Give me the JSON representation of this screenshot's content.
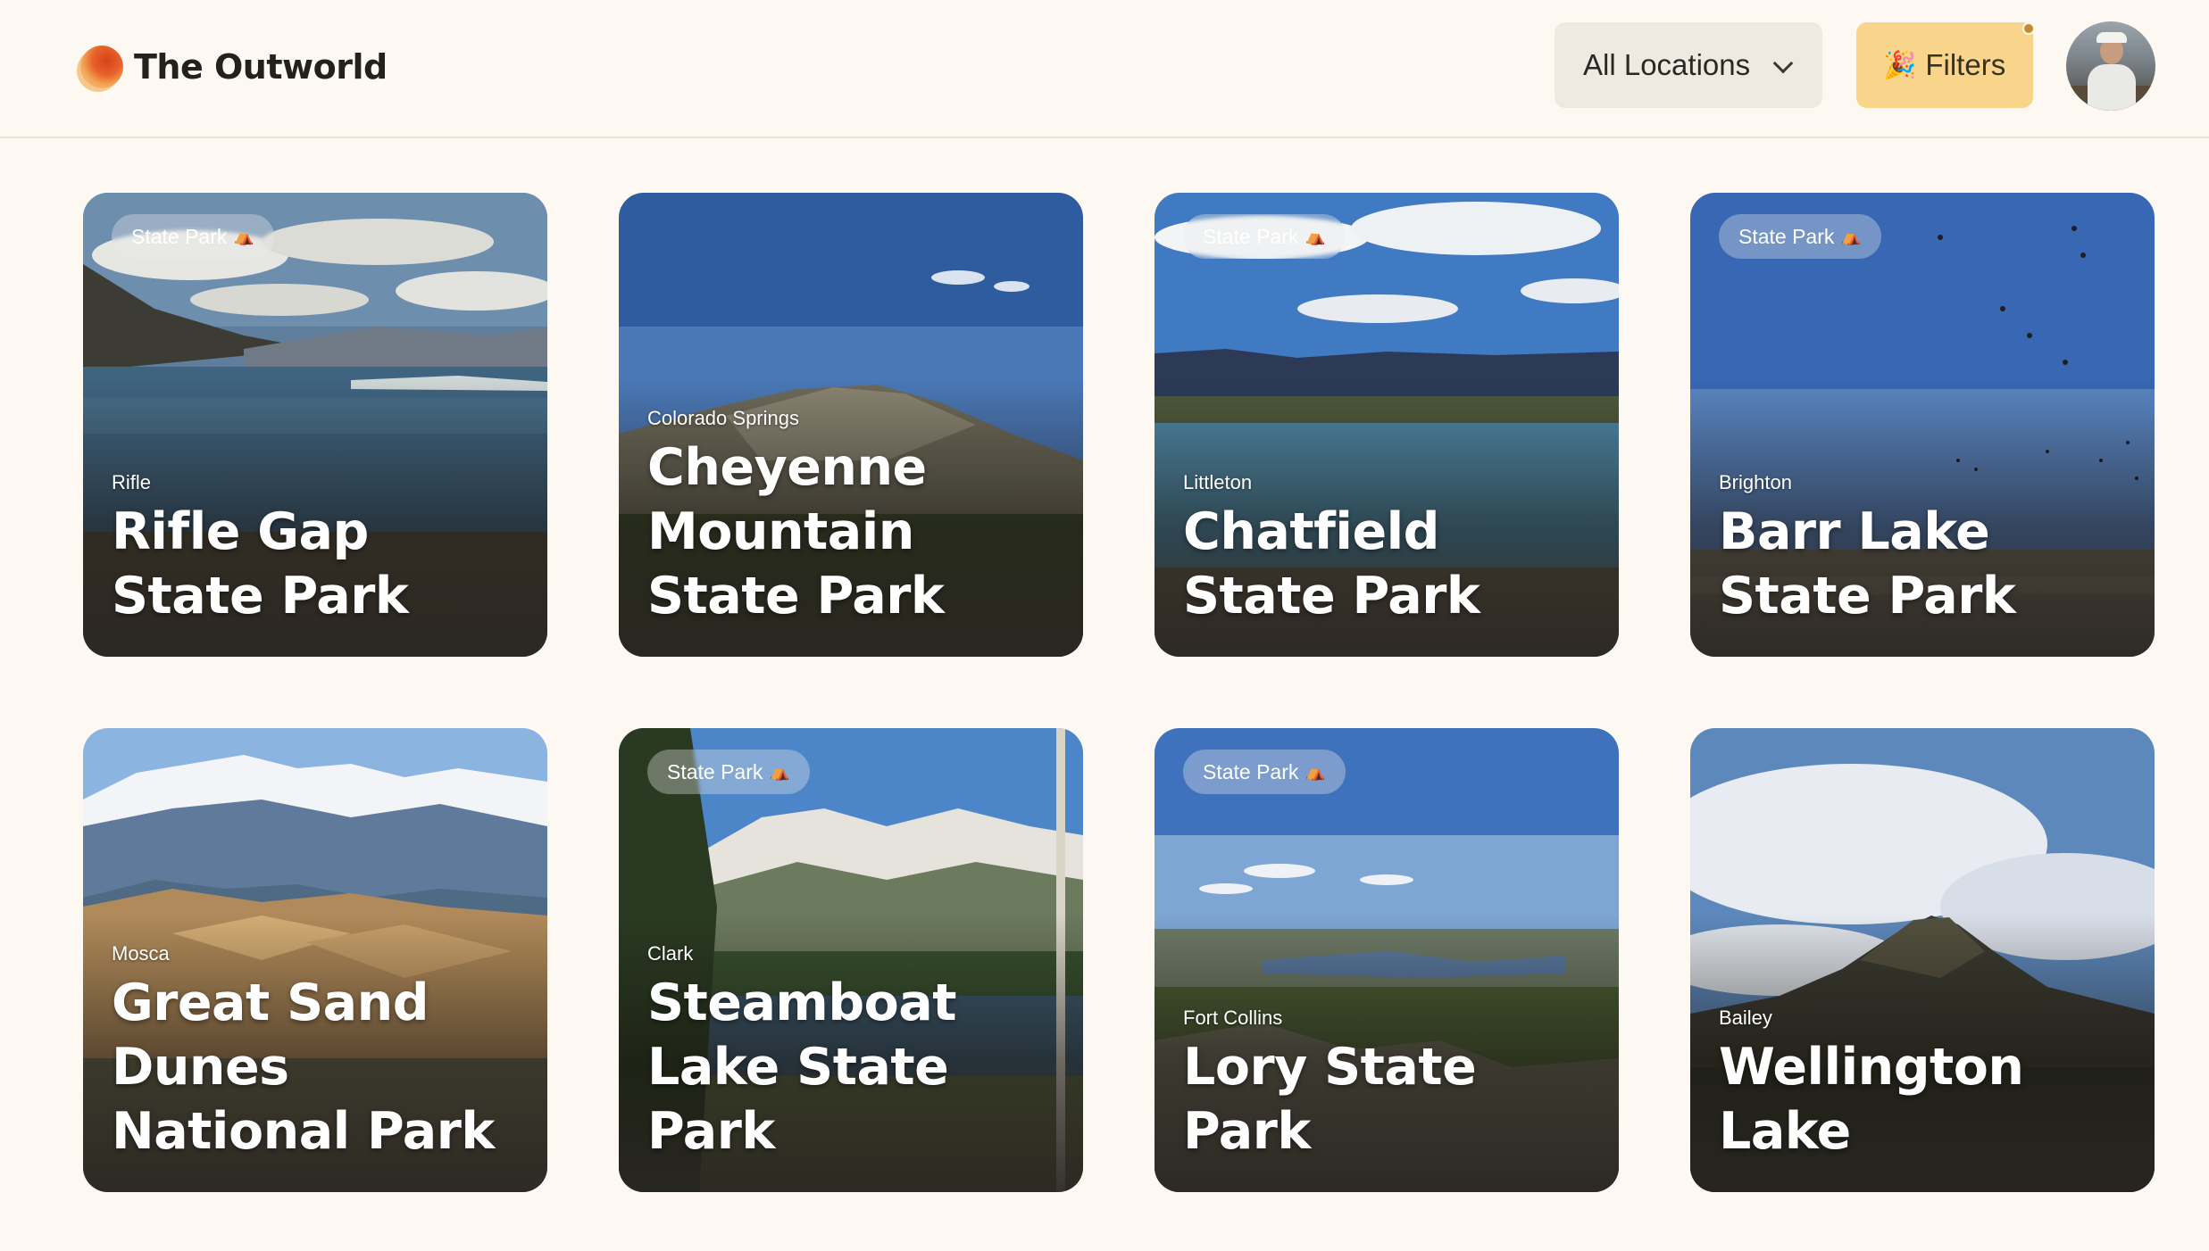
{
  "brand": {
    "name": "The Outworld"
  },
  "toolbar": {
    "locations_label": "All Locations",
    "filters_label": "Filters",
    "filters_emoji": "🎉",
    "accent": "#f8d58b"
  },
  "cards": [
    {
      "badge": "State Park",
      "city": "Rifle",
      "name": "Rifle Gap State Park"
    },
    {
      "badge": "",
      "city": "Colorado Springs",
      "name": "Cheyenne Mountain State Park"
    },
    {
      "badge": "State Park",
      "city": "Littleton",
      "name": "Chatfield State Park"
    },
    {
      "badge": "State Park",
      "city": "Brighton",
      "name": "Barr Lake State Park"
    },
    {
      "badge": "",
      "city": "Mosca",
      "name": "Great Sand Dunes National Park"
    },
    {
      "badge": "State Park",
      "city": "Clark",
      "name": "Steamboat Lake State Park"
    },
    {
      "badge": "State Park",
      "city": "Fort Collins",
      "name": "Lory State Park"
    },
    {
      "badge": "",
      "city": "Bailey",
      "name": "Wellington Lake"
    }
  ],
  "badge_icon": "⛺"
}
